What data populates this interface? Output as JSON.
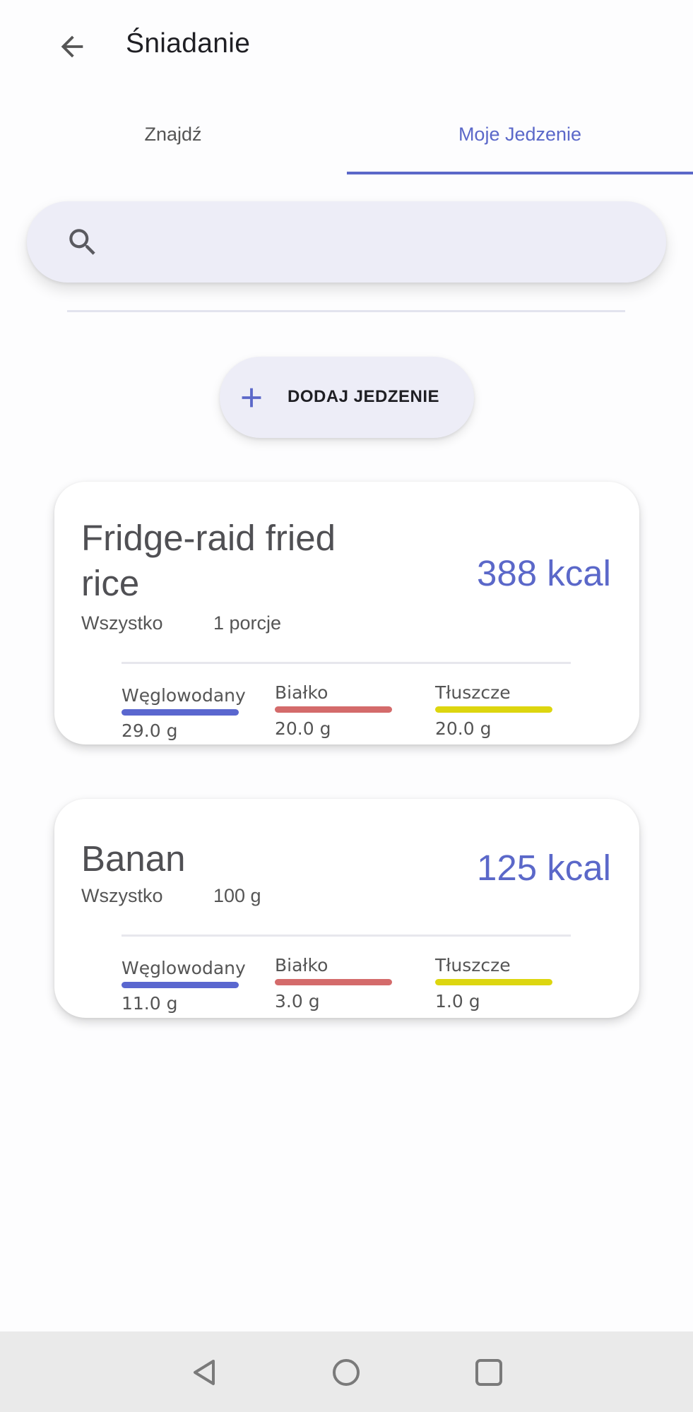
{
  "header": {
    "title": "Śniadanie"
  },
  "tabs": [
    {
      "label": "Znajdź",
      "active": false
    },
    {
      "label": "Moje Jedzenie",
      "active": true
    }
  ],
  "search": {
    "placeholder": "",
    "value": ""
  },
  "add_food_button": {
    "label": "DODAJ JEDZENIE"
  },
  "foods": [
    {
      "name": "Fridge-raid fried rice",
      "kcal": "388 kcal",
      "portion_label": "Wszystko",
      "portion_value": "1 porcje",
      "macros": [
        {
          "name": "Węglowodany",
          "value": "29.0 g"
        },
        {
          "name": "Białko",
          "value": "20.0 g"
        },
        {
          "name": "Tłuszcze",
          "value": "20.0 g"
        }
      ]
    },
    {
      "name": "Banan",
      "kcal": "125 kcal",
      "portion_label": "Wszystko",
      "portion_value": "100 g",
      "macros": [
        {
          "name": "Węglowodany",
          "value": "11.0 g"
        },
        {
          "name": "Białko",
          "value": "3.0 g"
        },
        {
          "name": "Tłuszcze",
          "value": "1.0 g"
        }
      ]
    }
  ],
  "colors": {
    "accent": "#5b68c9",
    "carbs": "#5a67cf",
    "protein": "#d46b6b",
    "fat": "#ddd60f",
    "surface": "#ededf7"
  },
  "icons": [
    "back-arrow-icon",
    "search-icon",
    "plus-icon",
    "nav-back-icon",
    "nav-home-icon",
    "nav-recents-icon"
  ]
}
